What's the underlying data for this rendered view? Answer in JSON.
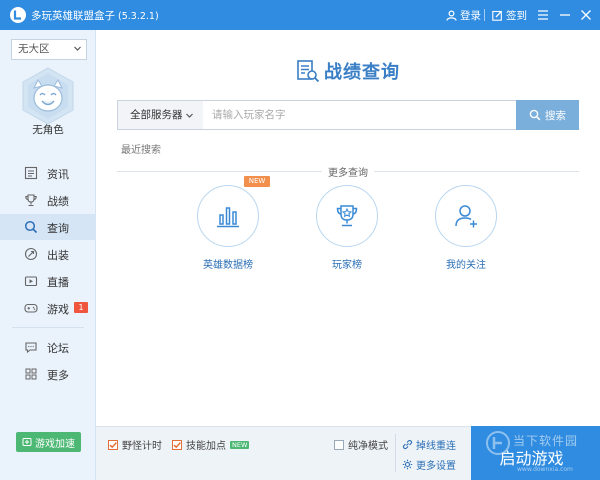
{
  "window": {
    "title": "多玩英雄联盟盒子",
    "version": "(5.3.2.1)",
    "login_label": "登录",
    "checkin_label": "签到"
  },
  "sidebar": {
    "region": "无大区",
    "hero_name": "无角色",
    "nav_items": [
      {
        "label": "资讯",
        "icon": "news-icon"
      },
      {
        "label": "战绩",
        "icon": "trophy-icon"
      },
      {
        "label": "查询",
        "icon": "search-icon",
        "active": true
      },
      {
        "label": "出装",
        "icon": "equipment-icon"
      },
      {
        "label": "直播",
        "icon": "live-icon"
      },
      {
        "label": "游戏",
        "icon": "gamepad-icon",
        "badge": "1"
      },
      {
        "label": "论坛",
        "icon": "forum-icon"
      },
      {
        "label": "更多",
        "icon": "more-grid-icon"
      }
    ],
    "accelerator_label": "游戏加速"
  },
  "main": {
    "title": "战绩查询",
    "search": {
      "server_label": "全部服务器",
      "placeholder": "请输入玩家名字",
      "button_label": "搜索"
    },
    "recent_label": "最近搜索",
    "more_label": "更多查询",
    "quick_links": [
      {
        "label": "英雄数据榜",
        "icon": "bar-chart-icon",
        "tag": "NEW"
      },
      {
        "label": "玩家榜",
        "icon": "trophy-star-icon"
      },
      {
        "label": "我的关注",
        "icon": "add-user-icon"
      }
    ]
  },
  "bottom": {
    "jungle_timer": {
      "label": "野怪计时",
      "checked": true
    },
    "skill_points": {
      "label": "技能加点",
      "checked": true,
      "tag": "NEW"
    },
    "pure_mode": {
      "label": "纯净模式",
      "checked": false
    },
    "reconnect_label": "掉线重连",
    "settings_label": "更多设置",
    "start_label": "启动游戏",
    "watermark_text": "当下软件园",
    "watermark_url": "www.downxia.com"
  },
  "colors": {
    "titlebar": "#2f8ce0",
    "accent": "#3a7fc6",
    "sidebar_bg": "#eaf2fb",
    "badge": "#f0553d",
    "accelerator": "#4cb874",
    "new_tag": "#f38f4c"
  }
}
